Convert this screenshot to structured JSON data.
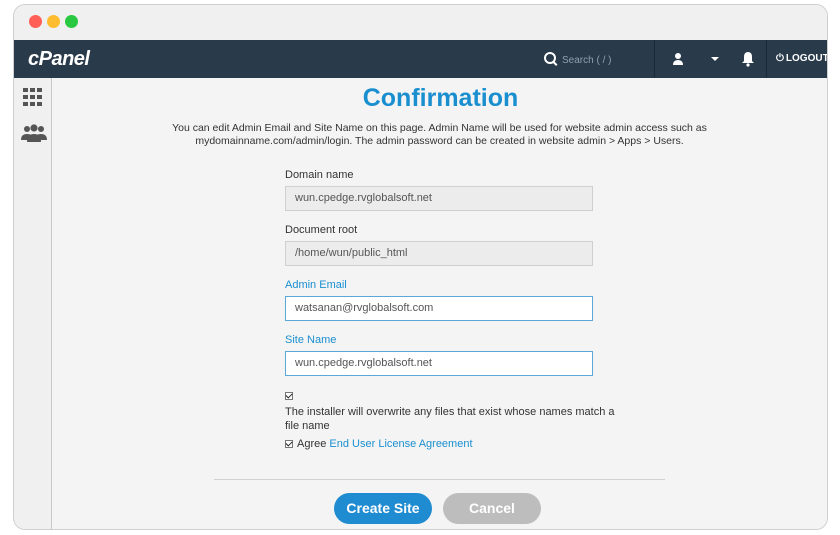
{
  "app": {
    "logo": "cPanel",
    "search_placeholder": "Search ( / )",
    "logout_label": "LOGOUT"
  },
  "page": {
    "title": "Confirmation",
    "description": "You can edit Admin Email and Site Name on this page. Admin Name will be used for website admin access such as mydomainname.com/admin/login. The admin password can be created in website admin > Apps > Users."
  },
  "form": {
    "domain_label": "Domain name",
    "domain_value": "wun.cpedge.rvglobalsoft.net",
    "docroot_label": "Document root",
    "docroot_value": "/home/wun/public_html",
    "email_label": "Admin Email",
    "email_value": "watsanan@rvglobalsoft.com",
    "site_label": "Site Name",
    "site_value": "wun.cpedge.rvglobalsoft.net",
    "overwrite_text": "The installer will overwrite any files that exist whose names match a file name",
    "agree_label": "Agree",
    "eula_link": "End User License Agreement",
    "overwrite_checked": true,
    "agree_checked": true
  },
  "buttons": {
    "create": "Create Site",
    "cancel": "Cancel"
  },
  "colors": {
    "topbar": "#293a4a",
    "accent": "#1a8fd0",
    "create_button": "#1f8bd0",
    "cancel_button": "#bdbdbd"
  }
}
